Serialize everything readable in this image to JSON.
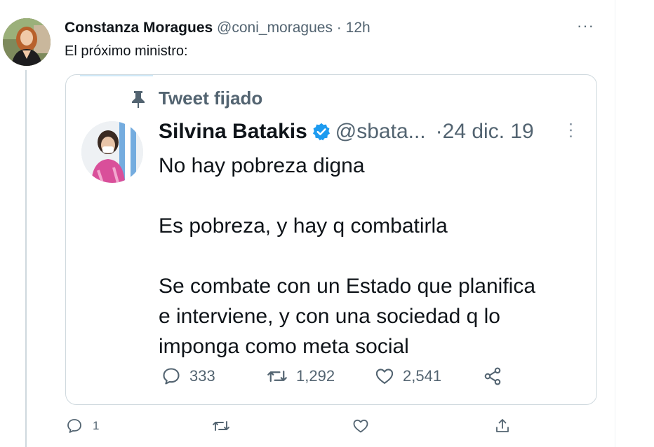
{
  "tweet": {
    "author_name": "Constanza Moragues",
    "handle": "@coni_moragues",
    "separator": "·",
    "time": "12h",
    "more": "···",
    "text": "El próximo ministro:",
    "actions": {
      "reply_count": "1",
      "retweet_count": "",
      "like_count": ""
    }
  },
  "quoted": {
    "pinned_label": "Tweet fijado",
    "author_name": "Silvina Batakis",
    "handle": "@sbata...",
    "separator": "·",
    "date": "24 dic. 19",
    "more": "···",
    "lines": [
      "No hay pobreza digna",
      "Es pobreza, y hay q combatirla",
      "Se combate con un Estado que planifica",
      "e interviene, y con una sociedad q lo",
      "imponga como meta social"
    ],
    "actions": {
      "reply_count": "333",
      "retweet_count": "1,292",
      "like_count": "2,541"
    }
  },
  "colors": {
    "verified": "#1d9bf0",
    "secondary_text": "#536471",
    "border": "#cfd9de"
  }
}
